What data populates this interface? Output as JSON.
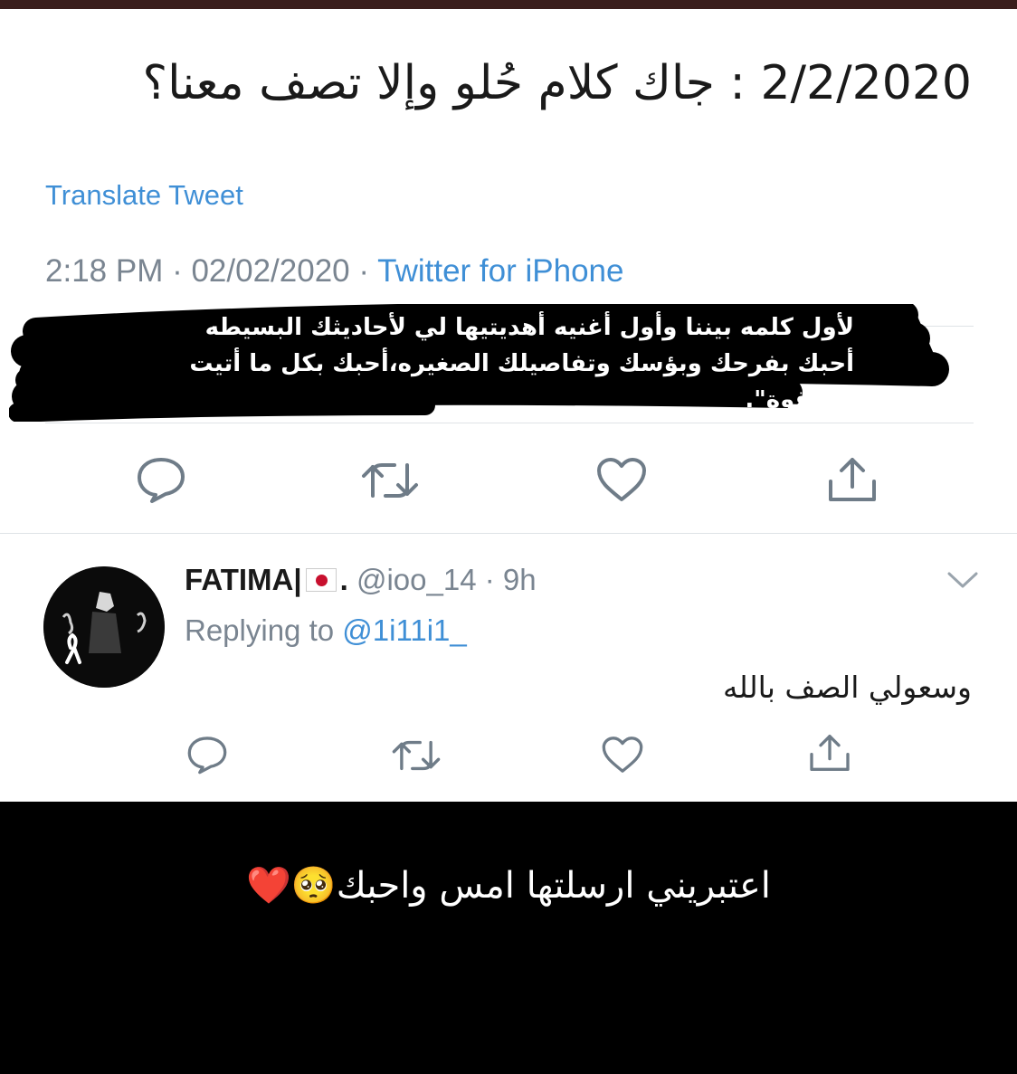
{
  "tweet": {
    "title": "2/2/2020 : جاك كلام حُلو وإلا تصف معنا؟",
    "translate_label": "Translate Tweet",
    "time": "2:18 PM",
    "sep1": " · ",
    "date": "02/02/2020",
    "sep2": " · ",
    "client": "Twitter for iPhone",
    "quote_line1": "لأول كلمه بيننا وأول أغنيه أهديتيها لي لأحاديثك البسيطه",
    "quote_line2": "أحبك بفرحك وبؤسك وتفاصيلك الصغيره،أحبك بكل ما أتيت",
    "quote_line3": "من قوة\".",
    "actions": [
      "reply-icon",
      "retweet-icon",
      "like-icon",
      "share-icon"
    ]
  },
  "reply": {
    "name": "FATIMA|",
    "flag_icon": "japan-flag-icon",
    "name_suffix": ".",
    "handle": " @ioo_14 · 9h",
    "replying_prefix": "Replying to ",
    "replying_to": "@1i11i1_",
    "text": "وسعولي الصف بالله",
    "actions": [
      "reply-icon",
      "retweet-icon",
      "like-icon",
      "share-icon"
    ]
  },
  "caption": {
    "text": "اعتبريني ارسلتها امس واحبك🥺❤️"
  },
  "colors": {
    "link": "#3f8fd6",
    "muted": "#7a8591",
    "icon": "#6f7c88",
    "caption_bg": "#000000"
  }
}
